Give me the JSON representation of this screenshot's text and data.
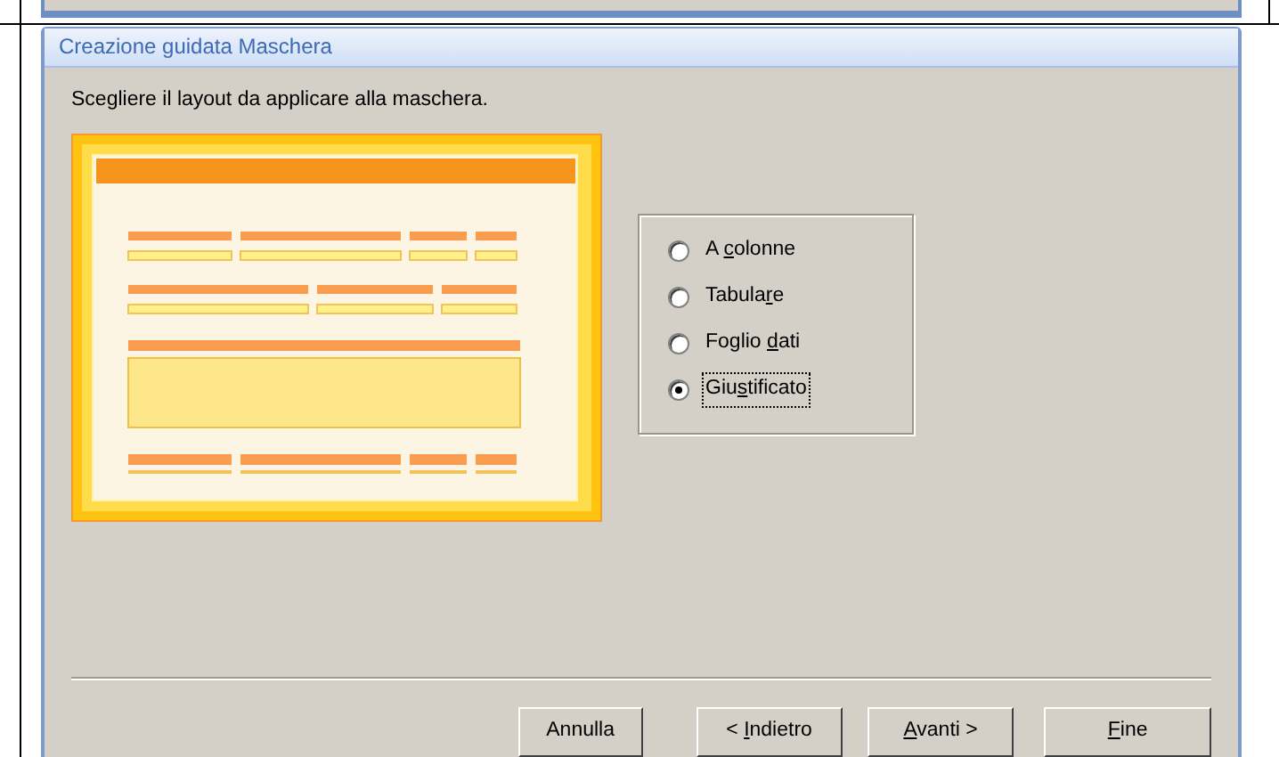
{
  "window": {
    "title": "Creazione guidata Maschera"
  },
  "instruction": "Scegliere il layout da applicare alla maschera.",
  "layout_options": [
    {
      "pre": "A ",
      "key": "c",
      "post": "olonne",
      "selected": false
    },
    {
      "pre": "Tabula",
      "key": "r",
      "post": "e",
      "selected": false
    },
    {
      "pre": "Foglio ",
      "key": "d",
      "post": "ati",
      "selected": false
    },
    {
      "pre": "Giu",
      "key": "s",
      "post": "tificato",
      "selected": true
    }
  ],
  "buttons": [
    {
      "post": "Annulla"
    },
    {
      "pre": "< ",
      "key": "I",
      "post": "ndietro"
    },
    {
      "key": "A",
      "post": "vanti >"
    },
    {
      "key": "F",
      "post": "ine"
    }
  ]
}
